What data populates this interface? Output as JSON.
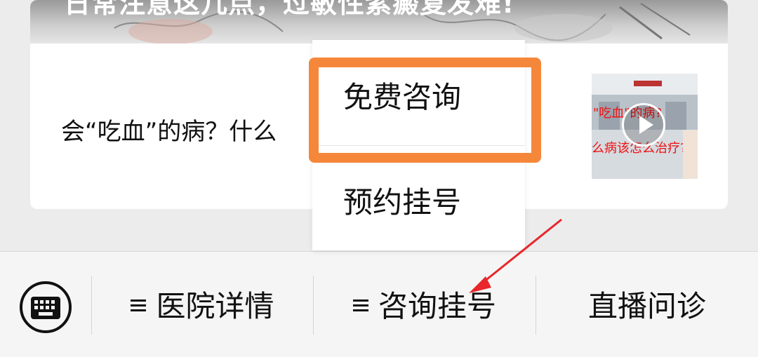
{
  "article": {
    "banner_title": "日常注意这几点，过敏性紫癜复发难!",
    "title": "会“吃血”的病？什么"
  },
  "popup": {
    "items": [
      {
        "label": "免费咨询"
      },
      {
        "label": "预约挂号"
      }
    ]
  },
  "menubar": {
    "keyboard_icon": "keyboard-icon",
    "items": [
      {
        "label": "医院详情",
        "has_submenu": true
      },
      {
        "label": "咨询挂号",
        "has_submenu": true
      },
      {
        "label": "直播问诊",
        "has_submenu": false
      }
    ]
  },
  "colors": {
    "highlight": "#f5873a",
    "arrow": "#e8262b"
  }
}
